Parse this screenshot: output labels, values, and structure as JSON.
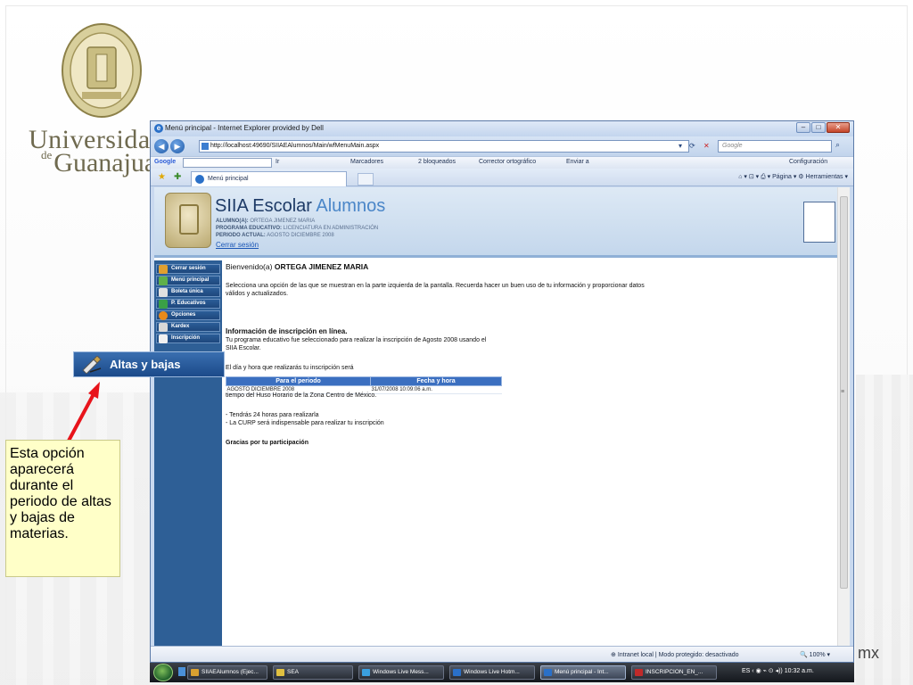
{
  "slide": {
    "university_line1": "Universidad",
    "university_de": "de",
    "university_line2": "Guanajuato",
    "footer_fragment": "mx",
    "callout_menu_label": "Altas y bajas",
    "note": "Esta opción aparecerá durante el periodo de altas y bajas de materias."
  },
  "browser": {
    "title": "Menú principal - Internet Explorer provided by Dell",
    "url": "http://localhost:49690/SIIAEAlumnos/Main/wfMenuMain.aspx",
    "search_placeholder": "Google",
    "toolbar": {
      "google_label": "Google",
      "go_label": "Ir",
      "bookmarks": "Marcadores",
      "blocked": "2 bloqueados",
      "spellcheck": "Corrector ortográfico",
      "send": "Enviar a",
      "settings": "Configuración"
    },
    "tab_title": "Menú principal",
    "tab_tools": {
      "page": "Página",
      "tools": "Herramientas"
    },
    "status": {
      "zone": "Intranet local | Modo protegido: desactivado",
      "zoom": "100%"
    }
  },
  "app": {
    "title": "SIIA Escolar",
    "title_suffix": "Alumnos",
    "alumno_label": "ALUMNO(A):",
    "alumno_value": "ORTEGA JIMENEZ MARIA",
    "programa_label": "PROGRAMA EDUCATIVO:",
    "programa_value": "LICENCIATURA EN ADMINISTRACIÓN",
    "periodo_label": "PERIODO ACTUAL:",
    "periodo_value": "AGOSTO DICIEMBRE 2008",
    "logout_link": "Cerrar sesión",
    "sidebar": [
      {
        "label": "Cerrar sesión"
      },
      {
        "label": "Menú principal"
      },
      {
        "label": "Boleta única"
      },
      {
        "label": "P. Educativos"
      },
      {
        "label": "Opciones"
      },
      {
        "label": "Kardex"
      },
      {
        "label": "Inscripción"
      }
    ],
    "welcome_prefix": "Bienvenido(a)",
    "welcome_name": "ORTEGA JIMENEZ MARIA",
    "intro_line1": "Selecciona una opción de las que se muestran en la parte izquierda de la pantalla. Recuerda hacer un buen uso de tu información y proporcionar datos",
    "intro_line2": "válidos y actualizados.",
    "section_title": "Información de inscripción en línea.",
    "section_line1": "Tu programa educativo fue seleccionado para realizar la inscripción de Agosto 2008 usando el",
    "section_line2": "SIIA Escolar.",
    "table_intro": "El día y hora que realizarás tu inscripción será",
    "table": {
      "headers": [
        "Para el periodo",
        "Fecha y hora"
      ],
      "rows": [
        [
          "AGOSTO DICIEMBRE 2008",
          "31/07/2008 10:09:06 a.m."
        ]
      ]
    },
    "timezone_note": "tiempo del Huso Horario de la Zona Centro de México.",
    "bullet1": "- Tendrás 24 horas para realizarla",
    "bullet2": "- La CURP será indispensable para realizar tu inscripción",
    "thanks": "Gracias por tu participación"
  },
  "taskbar": {
    "items": [
      {
        "label": "SIIAEAlumnos (Ejec..."
      },
      {
        "label": "SEA"
      },
      {
        "label": "Windows Live Mess..."
      },
      {
        "label": "Windows Live Hotm..."
      },
      {
        "label": "Menú principal - Int..."
      },
      {
        "label": "INSCRIPCION_EN_..."
      }
    ],
    "language": "ES",
    "clock": "10:32 a.m."
  },
  "colors": {
    "sidebar": "#2e5f96",
    "header": "#c4d7ec",
    "table_header": "#3b6fc0",
    "note_bg": "#ffffc8",
    "arrow": "#e8141b"
  }
}
